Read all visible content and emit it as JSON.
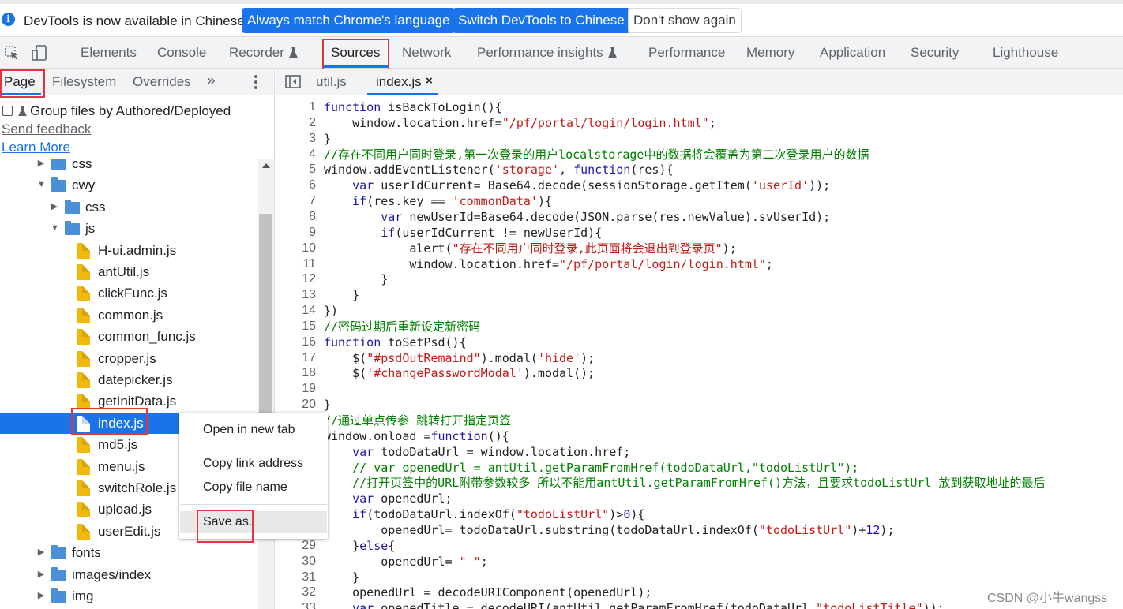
{
  "infobar": {
    "message": "DevTools is now available in Chinese!",
    "buttons": [
      "Always match Chrome's language",
      "Switch DevTools to Chinese",
      "Don't show again"
    ]
  },
  "main_toolbar": {
    "tabs": [
      "Elements",
      "Console",
      "Recorder",
      "Sources",
      "Network",
      "Performance insights",
      "Performance",
      "Memory",
      "Application",
      "Security",
      "Lighthouse"
    ],
    "active_tab": "Sources"
  },
  "navigator": {
    "tabs": [
      "Page",
      "Filesystem",
      "Overrides"
    ],
    "more_symbol": "»",
    "group_files_label": "Group files by Authored/Deployed",
    "send_feedback": "Send feedback",
    "learn_more": "Learn More",
    "tree": [
      {
        "type": "folder",
        "label": "css",
        "expanded": false
      },
      {
        "type": "folder",
        "label": "cwy",
        "expanded": true
      },
      {
        "type": "folder",
        "label": "css",
        "expanded": false
      },
      {
        "type": "folder",
        "label": "js",
        "expanded": true
      },
      {
        "type": "file",
        "label": "H-ui.admin.js"
      },
      {
        "type": "file",
        "label": "antUtil.js"
      },
      {
        "type": "file",
        "label": "clickFunc.js"
      },
      {
        "type": "file",
        "label": "common.js"
      },
      {
        "type": "file",
        "label": "common_func.js"
      },
      {
        "type": "file",
        "label": "cropper.js"
      },
      {
        "type": "file",
        "label": "datepicker.js"
      },
      {
        "type": "file",
        "label": "getInitData.js"
      },
      {
        "type": "file",
        "label": "index.js",
        "selected": true
      },
      {
        "type": "file",
        "label": "md5.js"
      },
      {
        "type": "file",
        "label": "menu.js"
      },
      {
        "type": "file",
        "label": "switchRole.js"
      },
      {
        "type": "file",
        "label": "upload.js"
      },
      {
        "type": "file",
        "label": "userEdit.js"
      },
      {
        "type": "folder",
        "label": "fonts",
        "expanded": false
      },
      {
        "type": "folder",
        "label": "images/index",
        "expanded": false
      },
      {
        "type": "folder",
        "label": "img",
        "expanded": false
      }
    ]
  },
  "editor": {
    "tabs": [
      "util.js",
      "index.js"
    ],
    "active_tab": "index.js",
    "close_symbol": "×",
    "lines": [
      {
        "n": "1",
        "text": "function isBackToLogin(){"
      },
      {
        "n": "2",
        "text": "    window.location.href=\"/pf/portal/login/login.html\";"
      },
      {
        "n": "3",
        "text": "}"
      },
      {
        "n": "4",
        "text": "//存在不同用户同时登录,第一次登录的用户localstorage中的数据将会覆盖为第二次登录用户的数据"
      },
      {
        "n": "5",
        "text": "window.addEventListener('storage', function(res){"
      },
      {
        "n": "6",
        "text": "    var userIdCurrent= Base64.decode(sessionStorage.getItem('userId'));"
      },
      {
        "n": "7",
        "text": "    if(res.key == 'commonData'){"
      },
      {
        "n": "8",
        "text": "        var newUserId=Base64.decode(JSON.parse(res.newValue).svUserId);"
      },
      {
        "n": "9",
        "text": "        if(userIdCurrent != newUserId){"
      },
      {
        "n": "10",
        "text": "            alert(\"存在不同用户同时登录,此页面将会退出到登录页\");"
      },
      {
        "n": "11",
        "text": "            window.location.href=\"/pf/portal/login/login.html\";"
      },
      {
        "n": "12",
        "text": "        }"
      },
      {
        "n": "13",
        "text": "    }"
      },
      {
        "n": "14",
        "text": "})"
      },
      {
        "n": "15",
        "text": "//密码过期后重新设定新密码"
      },
      {
        "n": "16",
        "text": "function toSetPsd(){"
      },
      {
        "n": "17",
        "text": "    $(\"#psdOutRemaind\").modal('hide');"
      },
      {
        "n": "18",
        "text": "    $('#changePasswordModal').modal();"
      },
      {
        "n": "19",
        "text": ""
      },
      {
        "n": "20",
        "text": "}"
      },
      {
        "n": "",
        "text": "//通过单点传参 跳转打开指定页签"
      },
      {
        "n": "",
        "text": "window.onload =function(){"
      },
      {
        "n": "",
        "text": "    var todoDataUrl = window.location.href;"
      },
      {
        "n": "",
        "text": "    // var openedUrl = antUtil.getParamFromHref(todoDataUrl,\"todoListUrl\");"
      },
      {
        "n": "",
        "text": "    //打开页签中的URL附带参数较多 所以不能用antUtil.getParamFromHref()方法，且要求todoListUrl 放到获取地址的最后"
      },
      {
        "n": "",
        "text": "    var openedUrl;"
      },
      {
        "n": "",
        "text": "    if(todoDataUrl.indexOf(\"todoListUrl\")>0){"
      },
      {
        "n": "",
        "text": "        openedUrl= todoDataUrl.substring(todoDataUrl.indexOf(\"todoListUrl\")+12);"
      },
      {
        "n": "29",
        "text": "    }else{"
      },
      {
        "n": "30",
        "text": "        openedUrl= \" \";"
      },
      {
        "n": "31",
        "text": "    }"
      },
      {
        "n": "32",
        "text": "    openedUrl = decodeURIComponent(openedUrl);"
      },
      {
        "n": "33",
        "text": "    var openedTitle = decodeURI(antUtil.getParamFromHref(todoDataUrl,\"todoListTitle\"));"
      }
    ]
  },
  "context_menu": {
    "items": [
      "Open in new tab",
      "Copy link address",
      "Copy file name",
      "Save as.."
    ],
    "hovered": "Save as.."
  },
  "watermark": "CSDN @小牛wangss",
  "colors": {
    "accent": "#1a73e8",
    "highlight_box": "#e2363f",
    "folder": "#4b8fd9",
    "file": "#f2b90d"
  }
}
